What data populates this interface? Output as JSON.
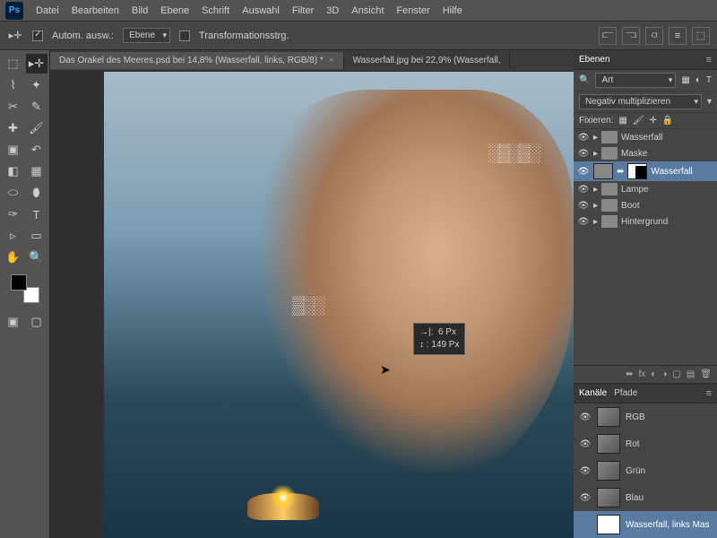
{
  "menubar": {
    "items": [
      "Datei",
      "Bearbeiten",
      "Bild",
      "Ebene",
      "Schrift",
      "Auswahl",
      "Filter",
      "3D",
      "Ansicht",
      "Fenster",
      "Hilfe"
    ]
  },
  "optbar": {
    "autoselect_label": "Autom. ausw.:",
    "autoselect_mode": "Ebene",
    "transform_label": "Transformationsstrg."
  },
  "tabs": [
    {
      "label": "Das Orakel des Meeres.psd bei 14,8% (Wasserfall, links, RGB/8) *",
      "active": true
    },
    {
      "label": "Wasserfall.jpg bei 22,9% (Wasserfall,",
      "active": false
    }
  ],
  "measure": {
    "w_label": "→|:",
    "w": "6 Px",
    "h_label": "↕ :",
    "h": "149 Px"
  },
  "layers_panel": {
    "tab": "Ebenen",
    "filter_label": "Art",
    "blend_mode": "Negativ multiplizieren",
    "lock_label": "Fixieren:",
    "layers": [
      {
        "name": "Wasserfall"
      },
      {
        "name": "Maske"
      },
      {
        "name": "Wasserfall",
        "selected": true,
        "hasMask": true
      },
      {
        "name": "Lampe"
      },
      {
        "name": "Boot"
      },
      {
        "name": "Hintergrund"
      }
    ]
  },
  "channels_panel": {
    "tabs": [
      "Kanäle",
      "Pfade"
    ],
    "channels": [
      {
        "name": "RGB"
      },
      {
        "name": "Rot"
      },
      {
        "name": "Grün"
      },
      {
        "name": "Blau"
      },
      {
        "name": "Wasserfall, links Mas",
        "mask": true
      }
    ]
  }
}
